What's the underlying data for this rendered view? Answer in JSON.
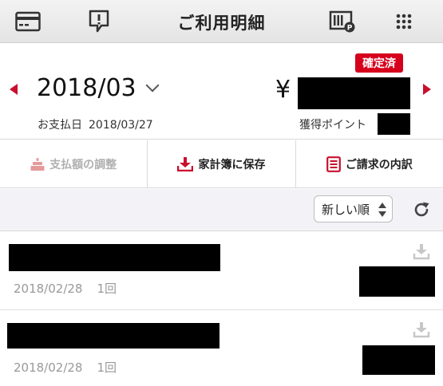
{
  "header": {
    "title": "ご利用明細",
    "icons": [
      "card-icon",
      "notice-icon",
      "barcode-pay-icon",
      "grid-menu-icon"
    ]
  },
  "summary": {
    "status_badge": "確定済",
    "month": "2018/03",
    "pay_date_label": "お支払日",
    "pay_date": "2018/03/27",
    "amount_prefix": "¥",
    "points_label": "獲得ポイント"
  },
  "actions": {
    "adjust_label": "支払額の調整",
    "save_label": "家計簿に保存",
    "breakdown_label": "ご請求の内訳"
  },
  "sort": {
    "selected": "新しい順"
  },
  "transactions": [
    {
      "date": "2018/02/28",
      "count": "1回"
    },
    {
      "date": "2018/02/28",
      "count": "1回"
    }
  ],
  "colors": {
    "accent": "#c8102e",
    "badge": "#d6001c"
  }
}
